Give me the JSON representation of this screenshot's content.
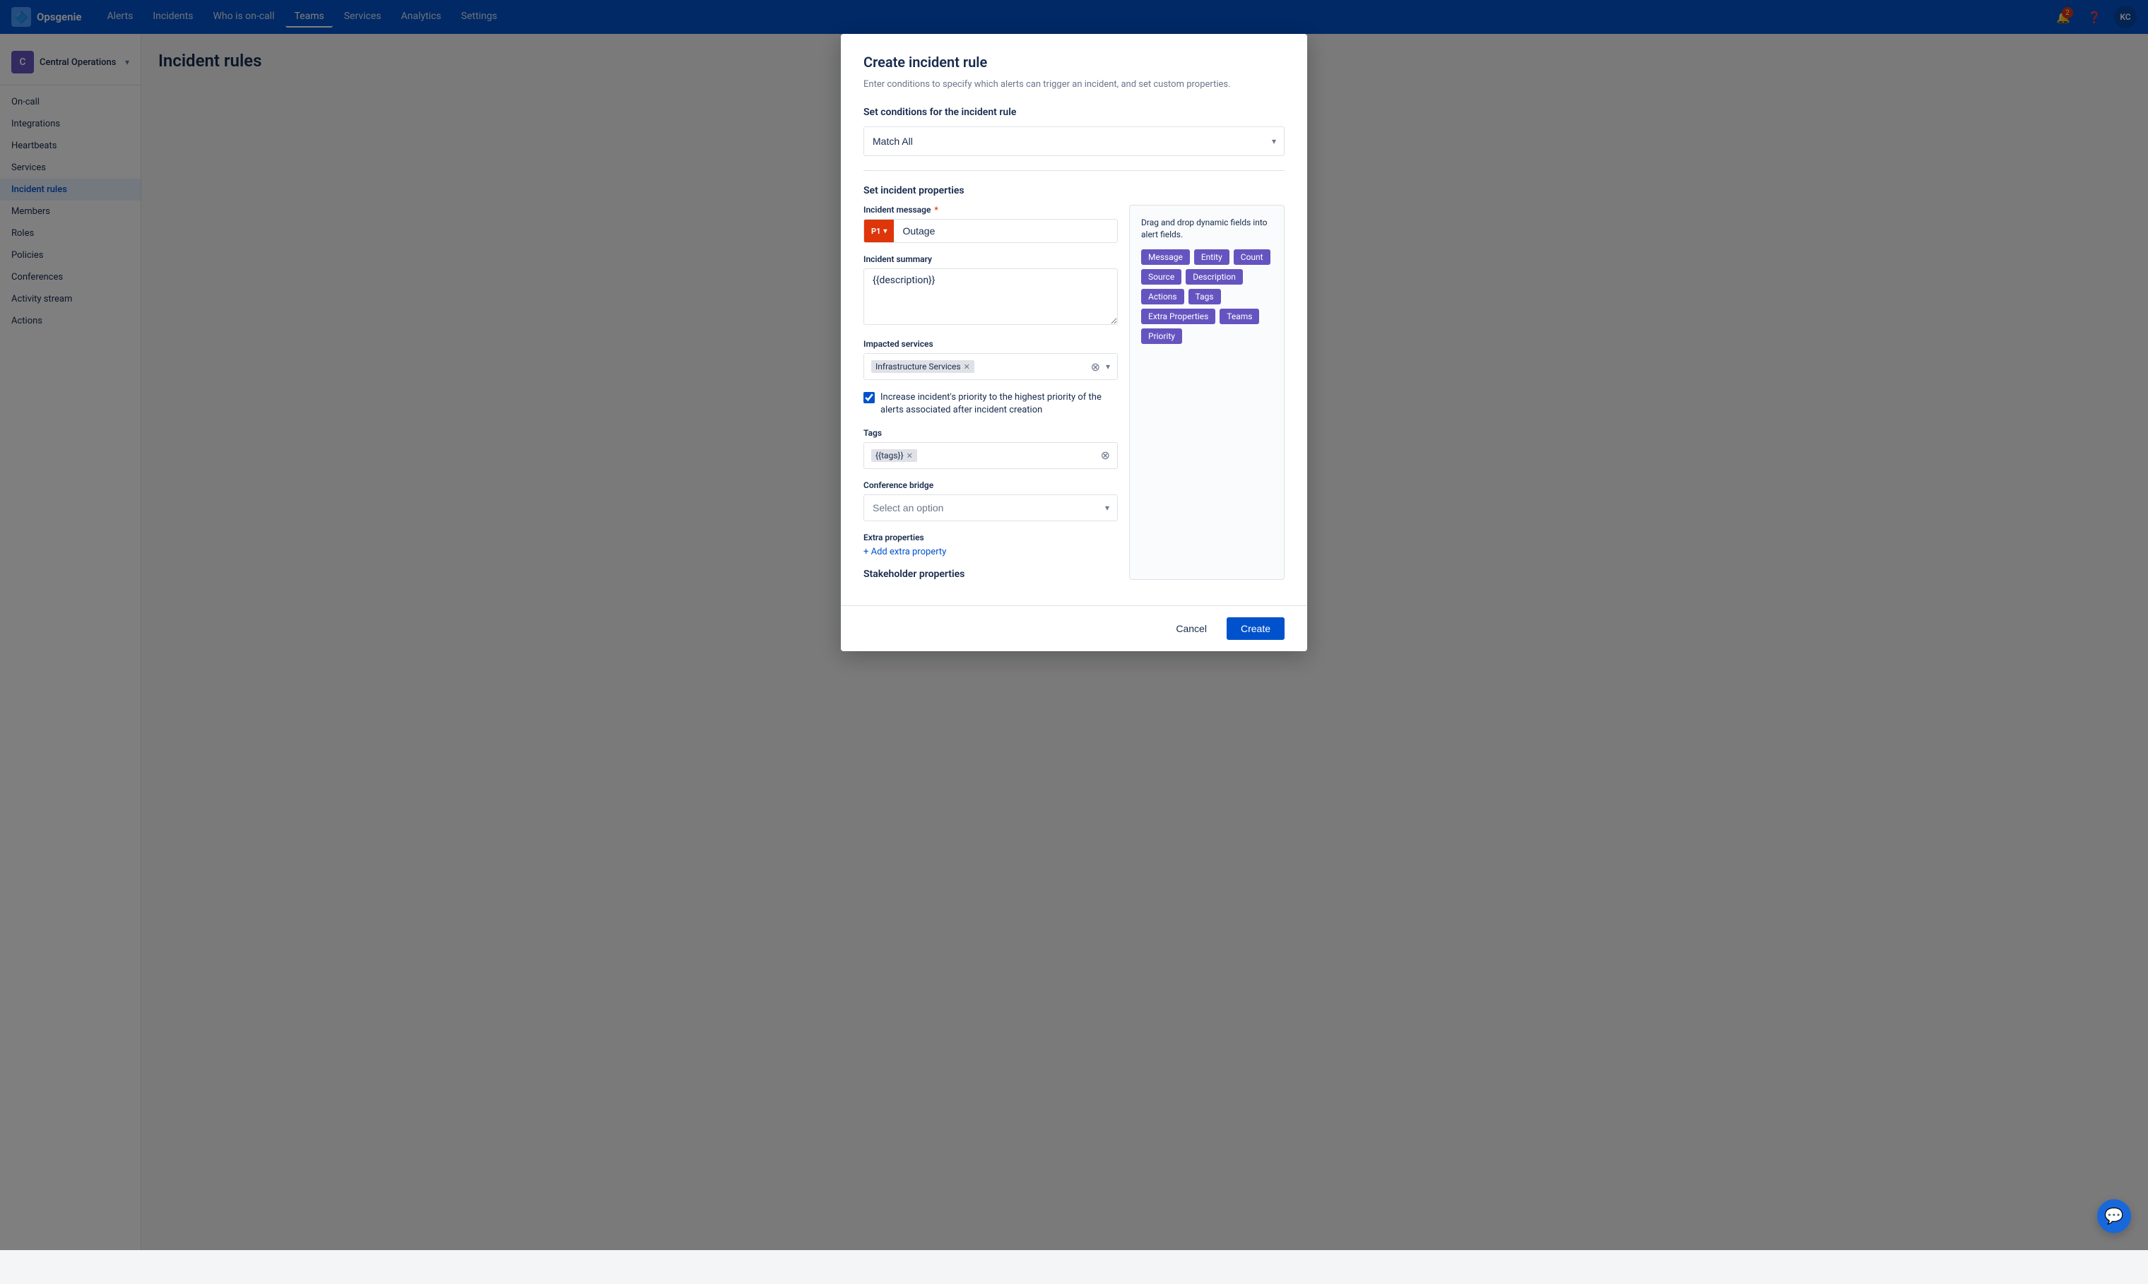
{
  "app": {
    "name": "Opsgenie",
    "logo_char": "🔷"
  },
  "topnav": {
    "links": [
      {
        "label": "Alerts",
        "active": false
      },
      {
        "label": "Incidents",
        "active": false
      },
      {
        "label": "Who is on-call",
        "active": false
      },
      {
        "label": "Teams",
        "active": true
      },
      {
        "label": "Services",
        "active": false
      },
      {
        "label": "Analytics",
        "active": false
      },
      {
        "label": "Settings",
        "active": false
      }
    ],
    "notification_count": "2",
    "avatar_initials": "KC"
  },
  "sidebar": {
    "team": {
      "name": "Central Operations",
      "initial": "C"
    },
    "items": [
      {
        "label": "On-call",
        "active": false
      },
      {
        "label": "Integrations",
        "active": false
      },
      {
        "label": "Heartbeats",
        "active": false
      },
      {
        "label": "Services",
        "active": false
      },
      {
        "label": "Incident rules",
        "active": true
      },
      {
        "label": "Members",
        "active": false
      },
      {
        "label": "Roles",
        "active": false
      },
      {
        "label": "Policies",
        "active": false
      },
      {
        "label": "Conferences",
        "active": false
      },
      {
        "label": "Activity stream",
        "active": false
      },
      {
        "label": "Actions",
        "active": false
      }
    ]
  },
  "page": {
    "title": "Incident rules"
  },
  "modal": {
    "title": "Create incident rule",
    "subtitle": "Enter conditions to specify which alerts can trigger an incident, and set custom properties.",
    "conditions_section_title": "Set conditions for the incident rule",
    "match_all_label": "Match All",
    "properties_section_title": "Set incident properties",
    "incident_message_label": "Incident message",
    "incident_message_required": true,
    "priority_label": "P1",
    "incident_message_value": "Outage",
    "incident_summary_label": "Incident summary",
    "incident_summary_value": "{{description}}",
    "impacted_services_label": "Impacted services",
    "impacted_services_value": "Infrastructure Services",
    "checkbox_label": "Increase incident's priority to the highest priority of the alerts associated after incident creation",
    "checkbox_checked": true,
    "tags_label": "Tags",
    "tags_value": "{{tags}}",
    "conference_bridge_label": "Conference bridge",
    "conference_bridge_placeholder": "Select an option",
    "extra_properties_label": "Extra properties",
    "add_extra_property_label": "+ Add extra property",
    "stakeholder_properties_label": "Stakeholder properties",
    "dynamic_fields": {
      "title": "Drag and drop dynamic fields into alert fields.",
      "tags": [
        "Message",
        "Entity",
        "Count",
        "Source",
        "Description",
        "Actions",
        "Tags",
        "Extra Properties",
        "Teams",
        "Priority"
      ]
    },
    "cancel_label": "Cancel",
    "create_label": "Create"
  }
}
